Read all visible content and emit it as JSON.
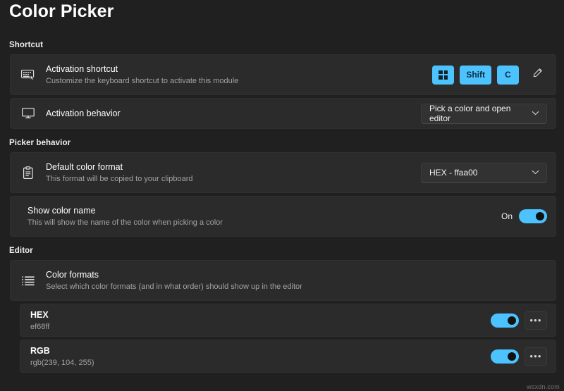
{
  "page": {
    "title": "Color Picker",
    "watermark": "wsxdn.com"
  },
  "colors": {
    "accent": "#4cc2ff",
    "background": "#202020",
    "card": "#2b2b2b",
    "text_primary": "#ffffff",
    "text_secondary": "#a3a3a3"
  },
  "sections": {
    "shortcut": {
      "header": "Shortcut",
      "activation_shortcut": {
        "icon": "keyboard-icon",
        "title": "Activation shortcut",
        "description": "Customize the keyboard shortcut to activate this module",
        "keys": [
          "windows-logo-icon",
          "Shift",
          "C"
        ],
        "edit_icon": "pencil-icon"
      },
      "activation_behavior": {
        "icon": "monitor-icon",
        "title": "Activation behavior",
        "dropdown_value": "Pick a color and open editor",
        "chevron": "chevron-down-icon"
      }
    },
    "picker_behavior": {
      "header": "Picker behavior",
      "default_color_format": {
        "icon": "clipboard-icon",
        "title": "Default color format",
        "description": "This format will be copied to your clipboard",
        "dropdown_value": "HEX - ffaa00",
        "chevron": "chevron-down-icon"
      },
      "show_color_name": {
        "title": "Show color name",
        "description": "This will show the name of the color when picking a color",
        "toggle_label": "On",
        "toggle_on": true
      }
    },
    "editor": {
      "header": "Editor",
      "color_formats": {
        "icon": "list-icon",
        "title": "Color formats",
        "description": "Select which color formats (and in what order) should show up in the editor"
      },
      "formats": [
        {
          "name": "HEX",
          "value": "ef68ff",
          "toggle_on": true,
          "more_label": "•••"
        },
        {
          "name": "RGB",
          "value": "rgb(239, 104, 255)",
          "toggle_on": true,
          "more_label": "•••"
        }
      ]
    }
  }
}
